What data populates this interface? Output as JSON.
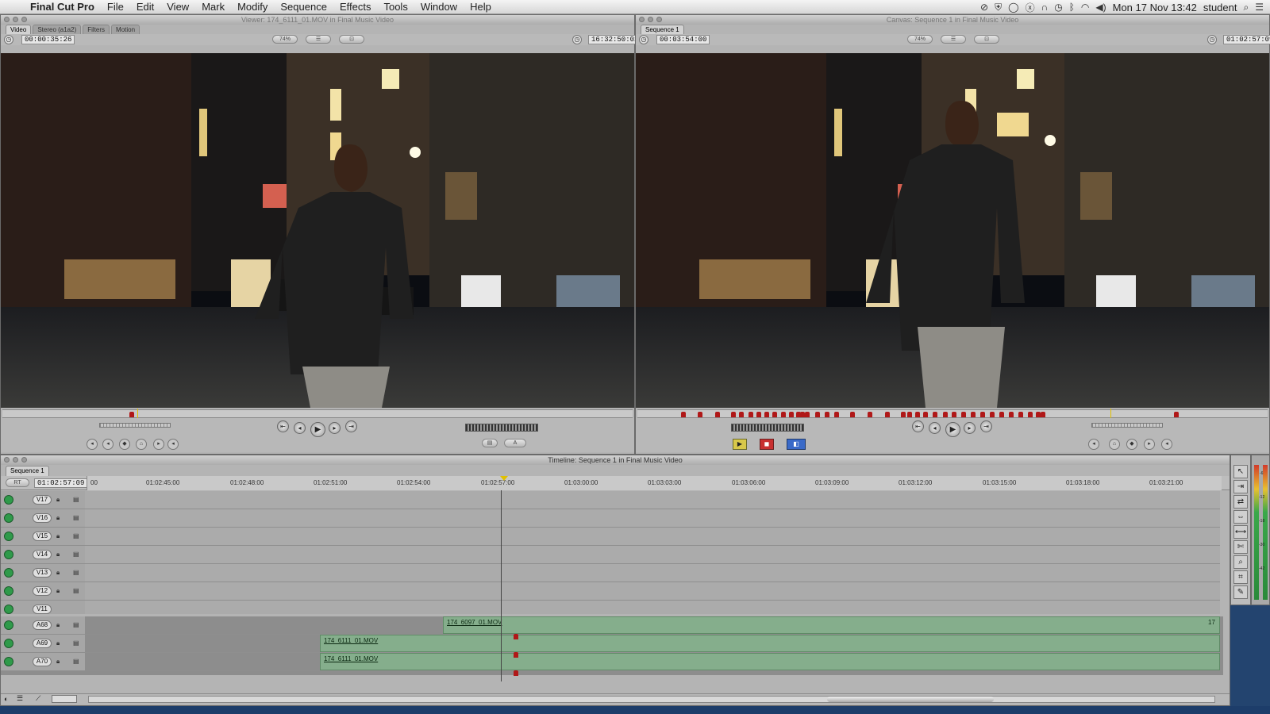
{
  "menubar": {
    "app_name": "Final Cut Pro",
    "items": [
      "File",
      "Edit",
      "View",
      "Mark",
      "Modify",
      "Sequence",
      "Effects",
      "Tools",
      "Window",
      "Help"
    ],
    "date_time": "Mon 17 Nov  13:42",
    "user": "student"
  },
  "viewer": {
    "title": "Viewer: 174_6111_01.MOV in Final Music Video",
    "tabs": [
      "Video",
      "Stereo (a1a2)",
      "Filters",
      "Motion"
    ],
    "active_tab": "Video",
    "duration_tc": "00:00:35:26",
    "current_tc": "16:32:50:02",
    "zoom_label": "74%",
    "view_label": "☰",
    "overlay_label": "⊡"
  },
  "canvas": {
    "title": "Canvas: Sequence 1 in Final Music Video",
    "tab": "Sequence 1",
    "duration_tc": "00:03:54:00",
    "current_tc": "01:02:57:09",
    "zoom_label": "74%",
    "view_label": "☰",
    "overlay_label": "⊡"
  },
  "timeline": {
    "title": "Timeline: Sequence 1 in Final Music Video",
    "sequence_tab": "Sequence 1",
    "rt_label": "RT",
    "current_tc": "01:02:57:09",
    "ruler": [
      "00",
      "01:02:45:00",
      "01:02:48:00",
      "01:02:51:00",
      "01:02:54:00",
      "01:02:57:00",
      "01:03:00:00",
      "01:03:03:00",
      "01:03:06:00",
      "01:03:09:00",
      "01:03:12:00",
      "01:03:15:00",
      "01:03:18:00",
      "01:03:21:00"
    ],
    "video_tracks": [
      "V17",
      "V16",
      "V15",
      "V14",
      "V13",
      "V12",
      "V11"
    ],
    "audio_tracks": [
      "A68",
      "A69",
      "A70"
    ],
    "clips": {
      "a68": "174_6097_01.MOV",
      "a69": "174_6111_01.MOV",
      "a70": "174_6111_01.MOV"
    },
    "clip_tail": "17"
  },
  "audio_meter": {
    "labels": [
      "0",
      "-6",
      "-12",
      "-18",
      "-24",
      "-30",
      "-36",
      "-42",
      "-48"
    ]
  },
  "colors": {
    "clip_green": "#85ae8c",
    "marker_red": "#b01818",
    "playhead_yellow": "#e0c000",
    "desktop_blue": "#1d3d6a"
  },
  "icons": [
    "apple-icon",
    "search-icon",
    "list-icon",
    "wifi-icon",
    "bluetooth-icon",
    "volume-icon",
    "eye-icon",
    "lock-icon",
    "speaker-icon",
    "play-icon",
    "mark-in-icon",
    "mark-out-icon",
    "arrow-tool-icon",
    "zoom-tool-icon"
  ]
}
